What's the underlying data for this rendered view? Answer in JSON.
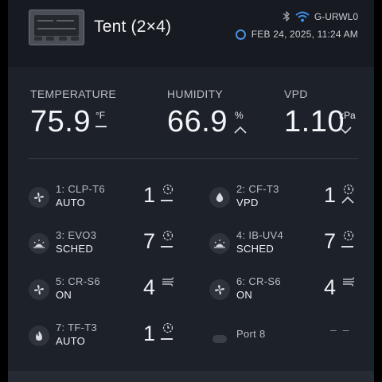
{
  "header": {
    "title": "Tent (2×4)",
    "device_id": "G-URWL0",
    "datetime": "FEB 24, 2025, 11:24 AM",
    "icons": [
      "bluetooth-icon",
      "wifi-icon",
      "clock-icon"
    ]
  },
  "metrics": [
    {
      "label": "TEMPERATURE",
      "value": "75.9",
      "unit": "°F",
      "trend": "steady"
    },
    {
      "label": "HUMIDITY",
      "value": "66.9",
      "unit": "%",
      "trend": "up"
    },
    {
      "label": "VPD",
      "value": "1.10",
      "unit": "kPa",
      "trend": "down"
    }
  ],
  "ports": [
    {
      "name": "1: CLP-T6",
      "mode": "AUTO",
      "level": "1",
      "icon": "fan-icon",
      "badge": "timer-icon",
      "indicator": "dash"
    },
    {
      "name": "2: CF-T3",
      "mode": "VPD",
      "level": "1",
      "icon": "water-drop-icon",
      "badge": "timer-icon",
      "indicator": "up"
    },
    {
      "name": "3: EVO3",
      "mode": "SCHED",
      "level": "7",
      "icon": "grow-light-icon",
      "badge": "timer-icon",
      "indicator": "dash"
    },
    {
      "name": "4: IB-UV4",
      "mode": "SCHED",
      "level": "7",
      "icon": "grow-light-icon",
      "badge": "timer-icon",
      "indicator": "dash"
    },
    {
      "name": "5: CR-S6",
      "mode": "ON",
      "level": "4",
      "icon": "fan-icon",
      "badge": "wind-icon",
      "indicator": "none"
    },
    {
      "name": "6: CR-S6",
      "mode": "ON",
      "level": "4",
      "icon": "fan-icon",
      "badge": "wind-icon",
      "indicator": "none"
    },
    {
      "name": "7: TF-T3",
      "mode": "AUTO",
      "level": "1",
      "icon": "flame-icon",
      "badge": "timer-icon",
      "indicator": "dash"
    },
    {
      "name": "Port 8",
      "mode": "",
      "level": "– –",
      "icon": "empty-port-icon",
      "badge": "",
      "indicator": "none"
    }
  ],
  "colors": {
    "accent": "#4a8fe0",
    "panel": "#1d2129",
    "header": "#171a20",
    "icon_bg": "#2f343c"
  }
}
